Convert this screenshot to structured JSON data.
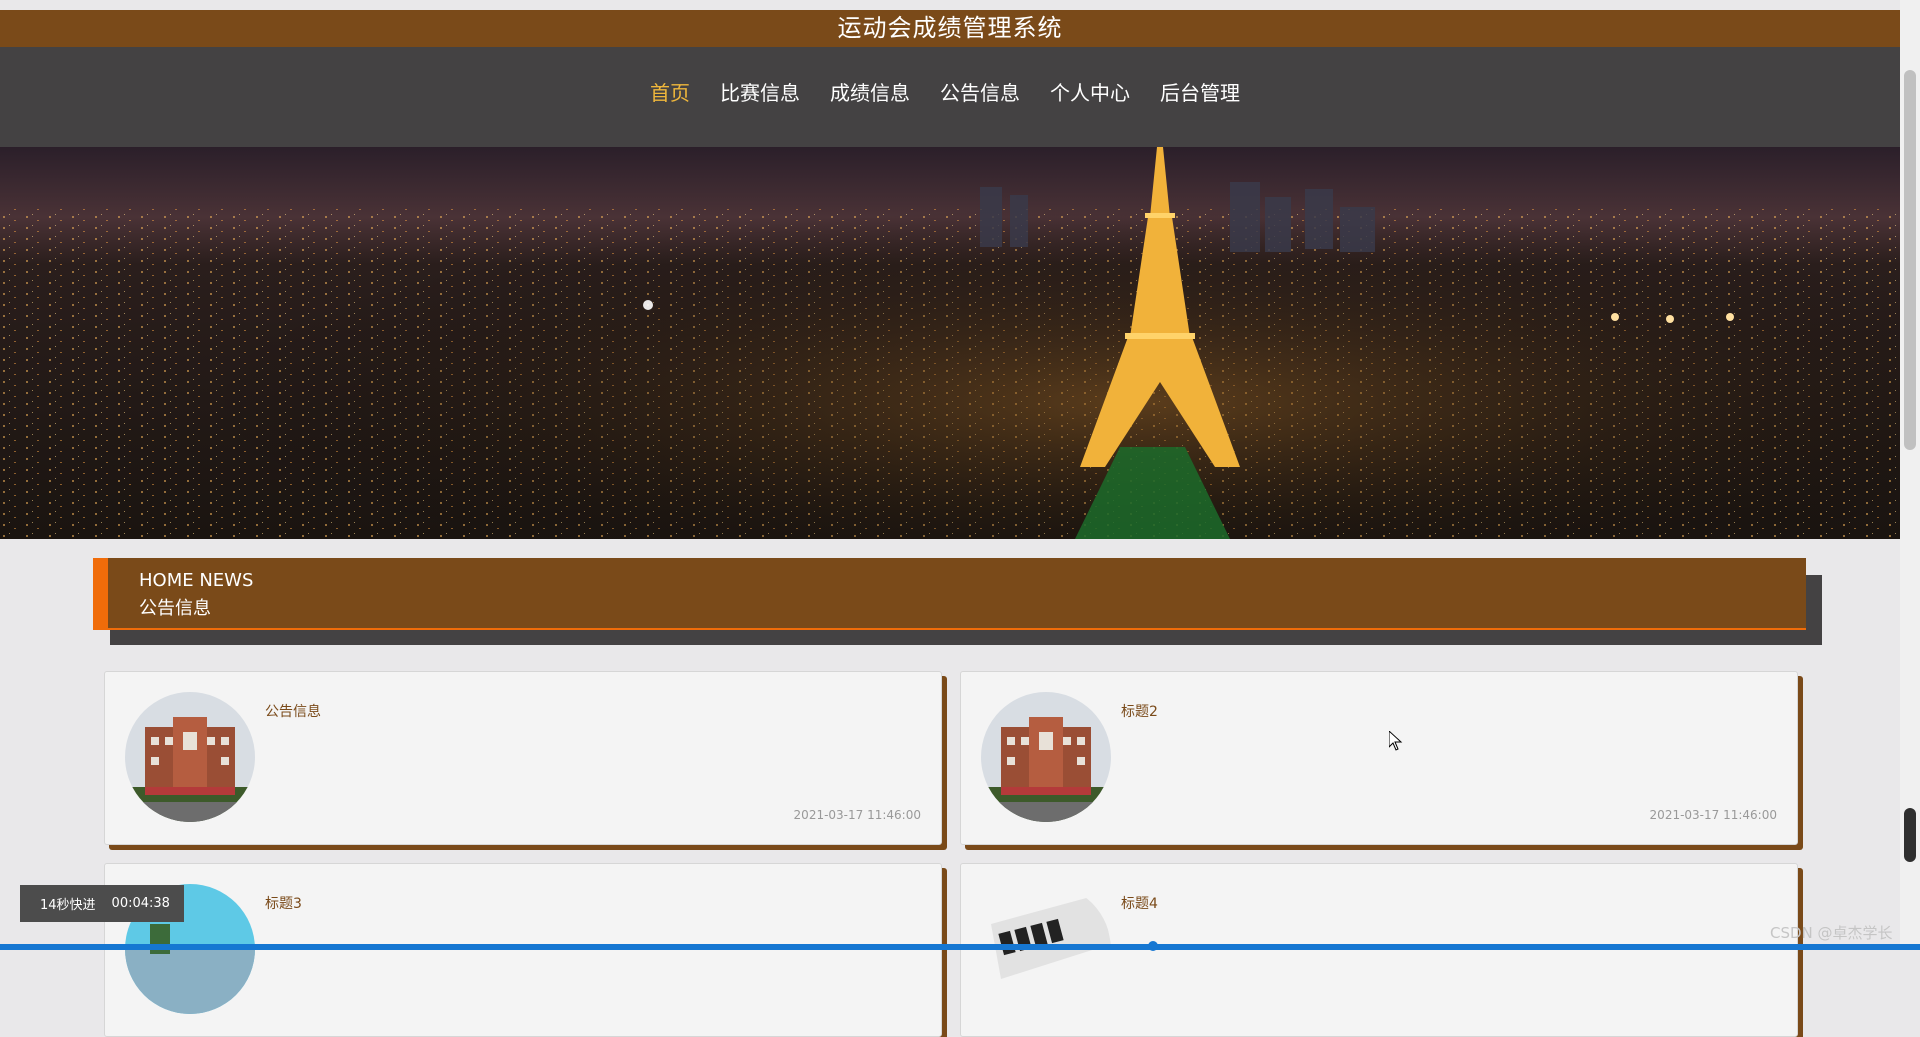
{
  "header": {
    "title": "运动会成绩管理系统"
  },
  "nav": {
    "items": [
      "首页",
      "比赛信息",
      "成绩信息",
      "公告信息",
      "个人中心",
      "后台管理"
    ],
    "active": "首页"
  },
  "banner": {
    "slides": 3,
    "current_slide": 1
  },
  "news_section": {
    "title_en": "HOME NEWS",
    "title_cn": "公告信息"
  },
  "news": [
    {
      "title": "公告信息",
      "time": "2021-03-17 11:46:00"
    },
    {
      "title": "标题2",
      "time": "2021-03-17 11:46:00"
    },
    {
      "title": "标题3",
      "time": ""
    },
    {
      "title": "标题4",
      "time": ""
    }
  ],
  "video": {
    "label": "14秒快进",
    "time": "00:04:38"
  },
  "watermark": "CSDN @卓杰学长",
  "colors": {
    "brand": "#7a4a19",
    "nav_bg": "#444243",
    "accent": "#f06c0a",
    "active_nav": "#f0b73b"
  }
}
